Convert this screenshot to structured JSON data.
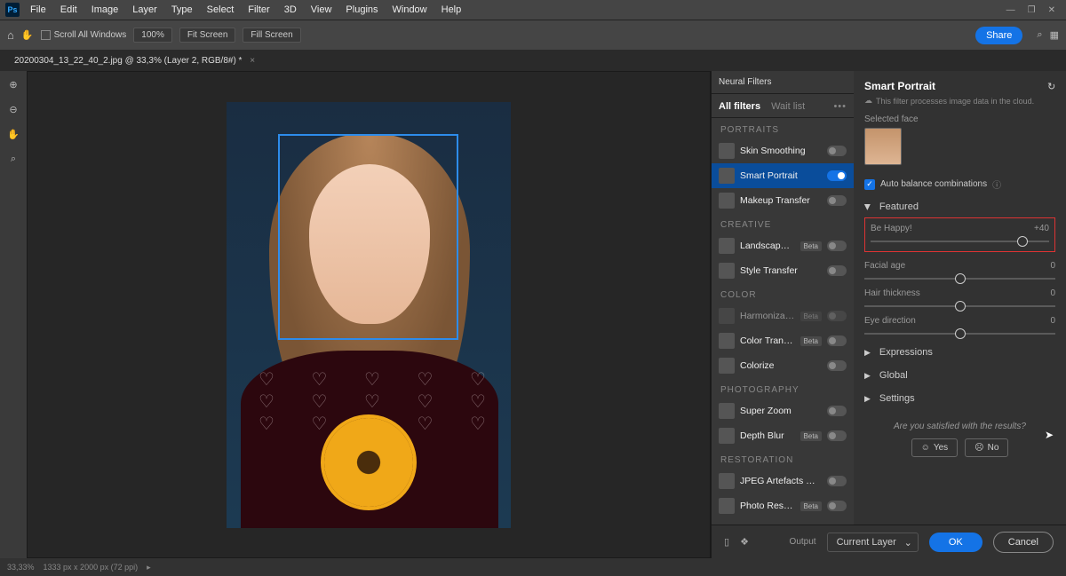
{
  "menubar": [
    "File",
    "Edit",
    "Image",
    "Layer",
    "Type",
    "Select",
    "Filter",
    "3D",
    "View",
    "Plugins",
    "Window",
    "Help"
  ],
  "options": {
    "scroll_all": "Scroll All Windows",
    "zoom": "100%",
    "fit": "Fit Screen",
    "fill": "Fill Screen",
    "share": "Share"
  },
  "doc_tab": "20200304_13_22_40_2.jpg @ 33,3% (Layer 2, RGB/8#) *",
  "panel_title": "Neural Filters",
  "tabs": {
    "all": "All filters",
    "wait": "Wait list"
  },
  "categories": [
    {
      "name": "PORTRAITS",
      "items": [
        {
          "label": "Skin Smoothing",
          "on": false
        },
        {
          "label": "Smart Portrait",
          "on": true,
          "active": true
        },
        {
          "label": "Makeup Transfer",
          "on": false
        }
      ]
    },
    {
      "name": "CREATIVE",
      "items": [
        {
          "label": "Landscape Mixer",
          "beta": true,
          "on": false
        },
        {
          "label": "Style Transfer",
          "on": false
        }
      ]
    },
    {
      "name": "COLOR",
      "items": [
        {
          "label": "Harmonization",
          "beta": true,
          "on": false,
          "dim": true
        },
        {
          "label": "Color Transfer",
          "beta": true,
          "on": false
        },
        {
          "label": "Colorize",
          "on": false
        }
      ]
    },
    {
      "name": "PHOTOGRAPHY",
      "items": [
        {
          "label": "Super Zoom",
          "on": false
        },
        {
          "label": "Depth Blur",
          "beta": true,
          "on": false
        }
      ]
    },
    {
      "name": "RESTORATION",
      "items": [
        {
          "label": "JPEG Artefacts Removal",
          "on": false
        },
        {
          "label": "Photo Restoration",
          "beta": true,
          "on": false
        }
      ]
    }
  ],
  "settings": {
    "title": "Smart Portrait",
    "cloud_note": "This filter processes image data in the cloud.",
    "selected_face": "Selected face",
    "auto_balance": "Auto balance combinations",
    "featured": "Featured",
    "sliders": [
      {
        "label": "Be Happy!",
        "value": "+40",
        "pos": 85,
        "highlight": true
      },
      {
        "label": "Facial age",
        "value": "0",
        "pos": 50
      },
      {
        "label": "Hair thickness",
        "value": "0",
        "pos": 50
      },
      {
        "label": "Eye direction",
        "value": "0",
        "pos": 50
      }
    ],
    "groups": [
      "Expressions",
      "Global",
      "Settings"
    ],
    "satisfied": "Are you satisfied with the results?",
    "yes": "Yes",
    "no": "No"
  },
  "footer": {
    "output_label": "Output",
    "output_value": "Current Layer",
    "ok": "OK",
    "cancel": "Cancel"
  },
  "status": {
    "zoom": "33,33%",
    "size": "1333 px x 2000 px (72 ppi)"
  },
  "beta_label": "Beta"
}
